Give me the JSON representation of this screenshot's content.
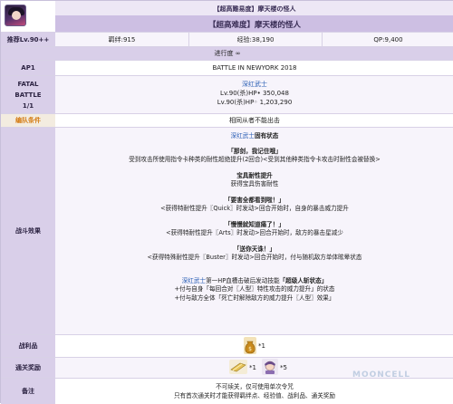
{
  "header": {
    "title_jp": "【超高難易度】摩天楼の怪人",
    "title_cn": "【超高难度】摩天楼的怪人"
  },
  "summary": {
    "label": "推荐Lv.90++",
    "bond": "羁绊:915",
    "exp": "经验:38,190",
    "qp": "QP:9,400"
  },
  "progress": {
    "value": "进行度 ∞"
  },
  "ap": {
    "label": "AP1",
    "value": "BATTLE IN NEWYORK 2018"
  },
  "fatal": {
    "label_line1": "FATAL",
    "label_line2": "BATTLE",
    "label_line3": "1/1",
    "enemy_name": "深红武士",
    "enemy_line1": "Lv.90(杀)HP• 350,048",
    "enemy_line2": "Lv.90(杀)HP◦ 1,203,290"
  },
  "restriction": {
    "label": "编队条件",
    "value": "相同从者不能出击"
  },
  "effects": {
    "label": "战斗效果",
    "head_name": "深红武士",
    "head_suffix": "固有状态",
    "s1_title": "「那剑，我记住哦」",
    "s1_desc": "受到攻击所使用指令卡种类的耐性超绝提升(2回合)<受到其他种类指令卡攻击时耐性会被替换>",
    "s2_title": "宝具耐性提升",
    "s2_desc": "获得宝具伤害耐性",
    "s3_title": "「要害全都看到啦！」",
    "s3_desc": "<获得特耐性提升〖Quick〗时发动>回合开始时，自身的暴击威力提升",
    "s4_title": "「慢慢就知道痛了！」",
    "s4_desc": "<获得特耐性提升〖Arts〗时发动>回合开始时，敌方的暴击星减少",
    "s5_title": "「送你天诛！」",
    "s5_desc": "<获得特殊耐性提升〖Buster〗时发动>回合开始时，付与随机敌方单体眩晕状态",
    "f_name": "深红武士",
    "f_mid": "第一HP血槽击破后发动技能",
    "f_skill": "「超级人斩状态」",
    "f_line2": "+付与自身「每回合对〖人型〗特性攻击的威力提升」的状态",
    "f_line3": "+付与敌方全体「死亡时解除敌方的威力提升〖人型〗效果」"
  },
  "drops": {
    "label": "战利品",
    "qty": "*1",
    "icon": "coin-bag-icon"
  },
  "rewards": {
    "label": "通关奖励",
    "qty1": "*1",
    "qty2": "*5",
    "icon1": "golden-apple-icon",
    "icon2": "saint-quartz-icon"
  },
  "notes": {
    "label": "备注",
    "line1": "不可续关，仅可使用单次令咒",
    "line2": "只有首次通关时才能获得羁绊点、经验值、战利品、通关奖励"
  },
  "watermark": "MOONCELL"
}
